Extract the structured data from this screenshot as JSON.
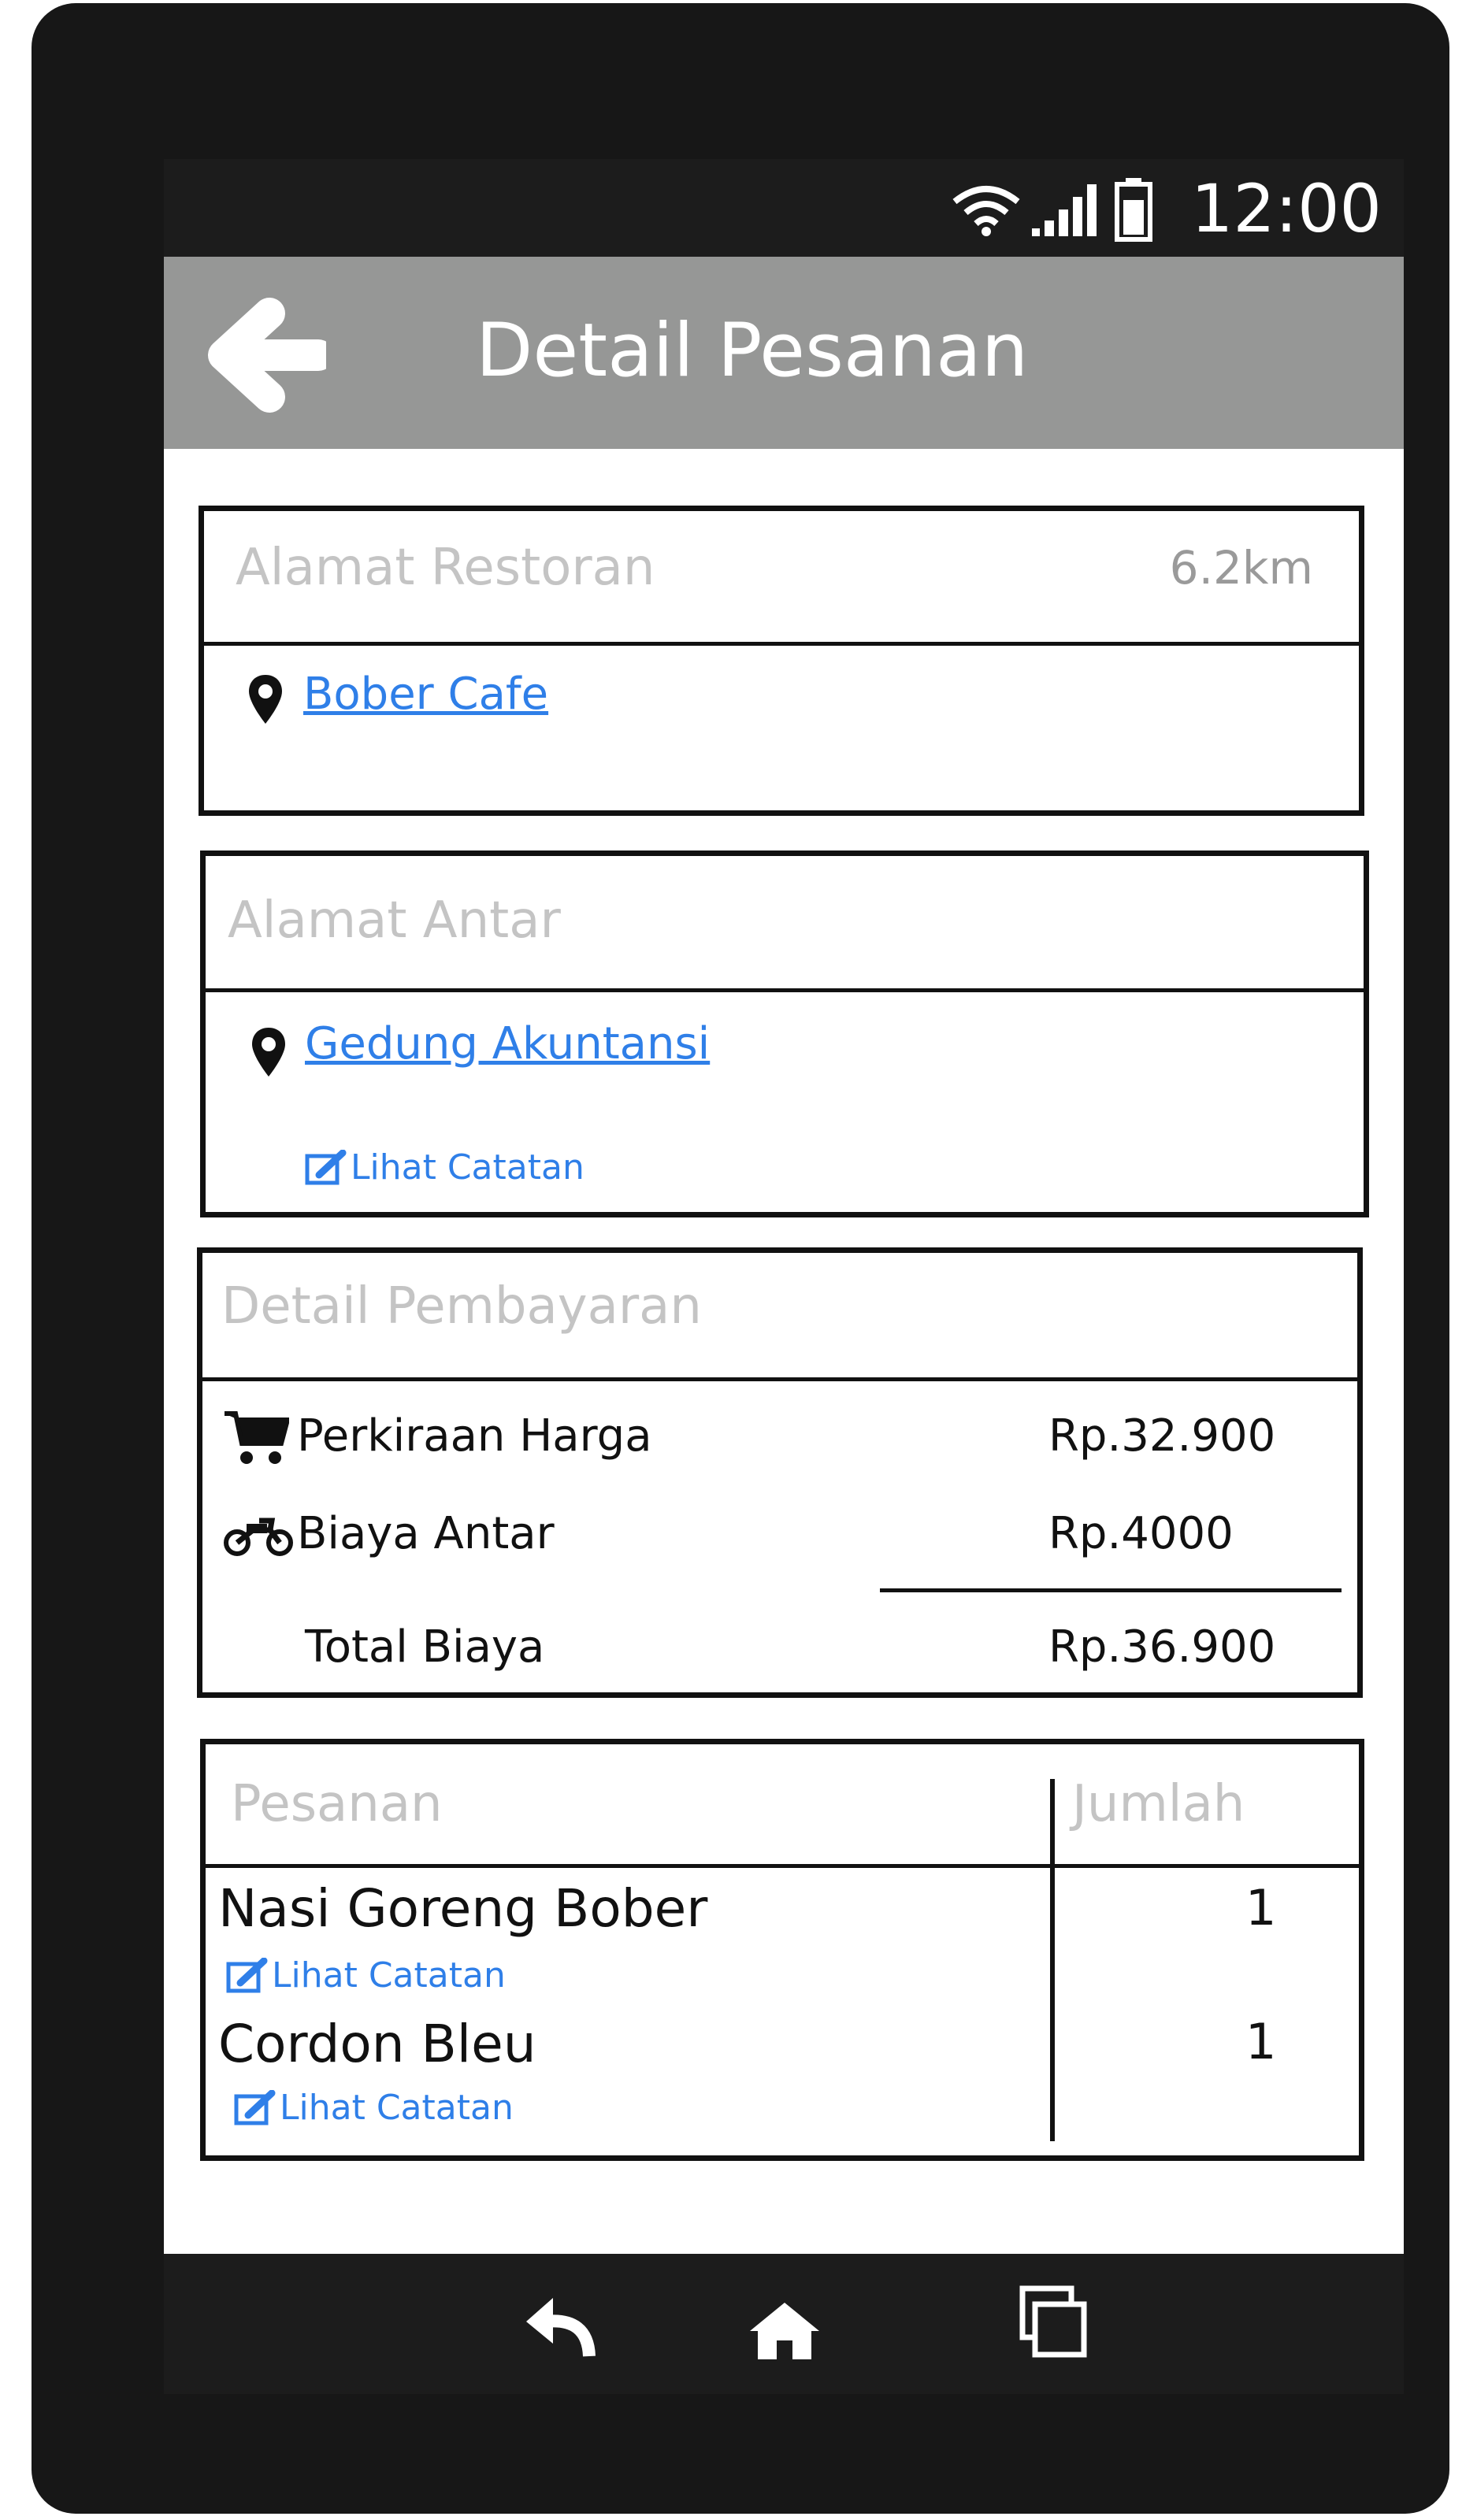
{
  "status_bar": {
    "time": "12:00"
  },
  "app_bar": {
    "title": "Detail Pesanan"
  },
  "restaurant": {
    "title": "Alamat Restoran",
    "distance": "6.2km",
    "name": "Bober Cafe"
  },
  "delivery": {
    "title": "Alamat Antar",
    "address": "Gedung Akuntansi",
    "note_link": "Lihat Catatan"
  },
  "payment": {
    "title": "Detail Pembayaran",
    "rows": [
      {
        "label": "Perkiraan Harga",
        "value": "Rp.32.900",
        "icon": "cart-icon"
      },
      {
        "label": "Biaya Antar",
        "value": "Rp.4000",
        "icon": "motorcycle-icon"
      }
    ],
    "total_label": "Total Biaya",
    "total_value": "Rp.36.900"
  },
  "orders": {
    "header_item": "Pesanan",
    "header_qty": "Jumlah",
    "items": [
      {
        "name": "Nasi Goreng Bober",
        "qty": "1",
        "note_link": "Lihat Catatan"
      },
      {
        "name": "Cordon Bleu",
        "qty": "1",
        "note_link": "Lihat Catatan"
      }
    ]
  },
  "colors": {
    "app_bar": "#969796",
    "link": "#2f7fe8",
    "muted_text": "#c4c4c4",
    "frame": "#171717"
  }
}
